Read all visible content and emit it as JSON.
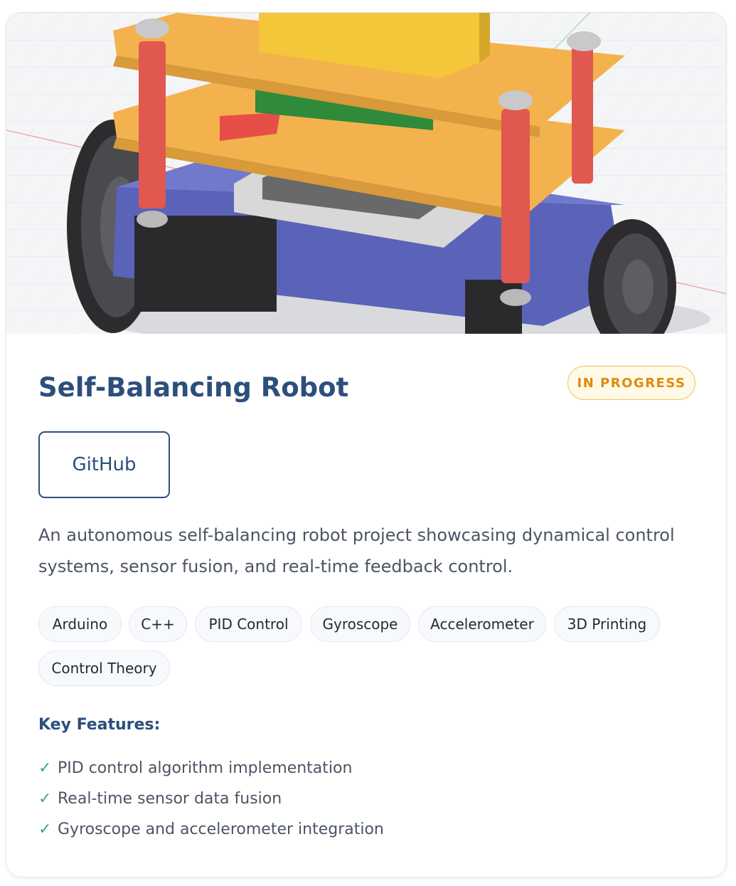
{
  "project": {
    "title": "Self-Balancing Robot",
    "status": "IN PROGRESS",
    "github_label": "GitHub",
    "description": "An autonomous self-balancing robot project showcasing dynamical control systems, sensor fusion, and real-time feedback control.",
    "tags": [
      "Arduino",
      "C++",
      "PID Control",
      "Gyroscope",
      "Accelerometer",
      "3D Printing",
      "Control Theory"
    ],
    "features_title": "Key Features:",
    "features": [
      "PID control algorithm implementation",
      "Real-time sensor data fusion",
      "Gyroscope and accelerometer integration"
    ],
    "check_symbol": "✓"
  },
  "colors": {
    "title": "#2c4f7c",
    "status_text": "#e08a0c",
    "status_border": "#f2c259",
    "check": "#3aa79b",
    "plate": "#f3b24e",
    "chassis": "#5a63b8",
    "standoff": "#e0584f",
    "block_yellow": "#f4c63a",
    "block_green": "#2f8a3a"
  }
}
